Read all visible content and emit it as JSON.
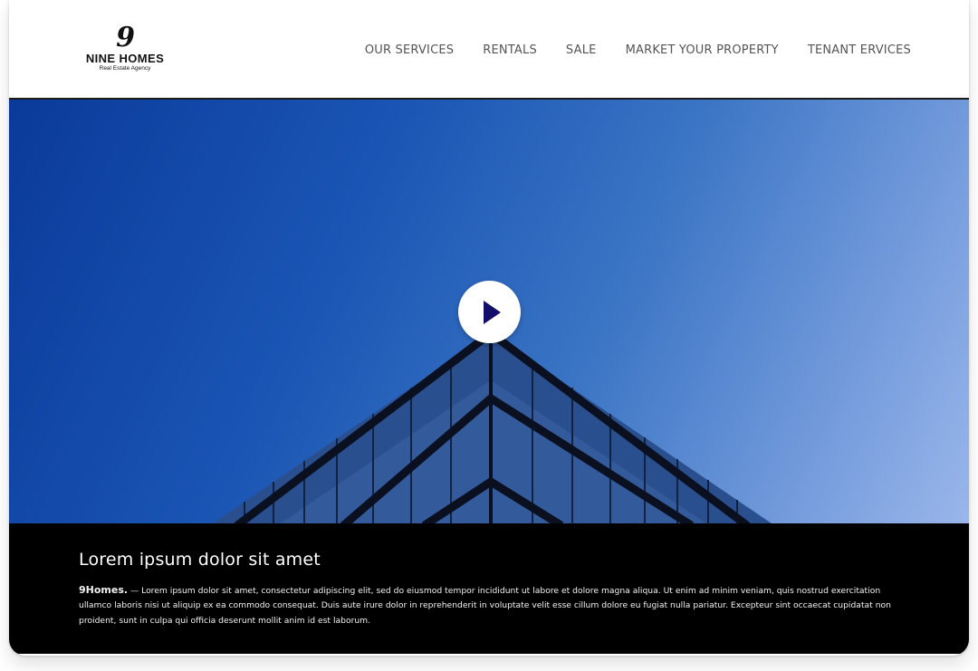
{
  "header": {
    "logo_mark": "9",
    "logo_brand": "NINE HOMES",
    "logo_tagline": "Real Estate Agency",
    "nav": [
      {
        "label": "OUR SERVICES"
      },
      {
        "label": "RENTALS"
      },
      {
        "label": "SALE"
      },
      {
        "label": "MARKET YOUR PROPERTY"
      },
      {
        "label": "TENANT ERVICES"
      }
    ]
  },
  "hero": {
    "play_icon": "play-icon",
    "colors": {
      "sky_start": "#0a3a9a",
      "sky_end": "#9ab6ea",
      "play_glyph": "#140e6b"
    }
  },
  "caption": {
    "title": "Lorem ipsum dolor sit amet",
    "brand": "9Homes.",
    "body": " — Lorem ipsum dolor sit amet, consectetur adipiscing elit, sed do eiusmod tempor incididunt ut labore et dolore magna aliqua. Ut enim ad minim veniam, quis nostrud exercitation ullamco laboris nisi ut aliquip ex ea commodo consequat. Duis aute irure dolor in reprehenderit in voluptate velit esse cillum dolore eu fugiat nulla pariatur. Excepteur sint occaecat cupidatat non proident, sunt in culpa qui officia deserunt mollit anim id est laborum."
  }
}
